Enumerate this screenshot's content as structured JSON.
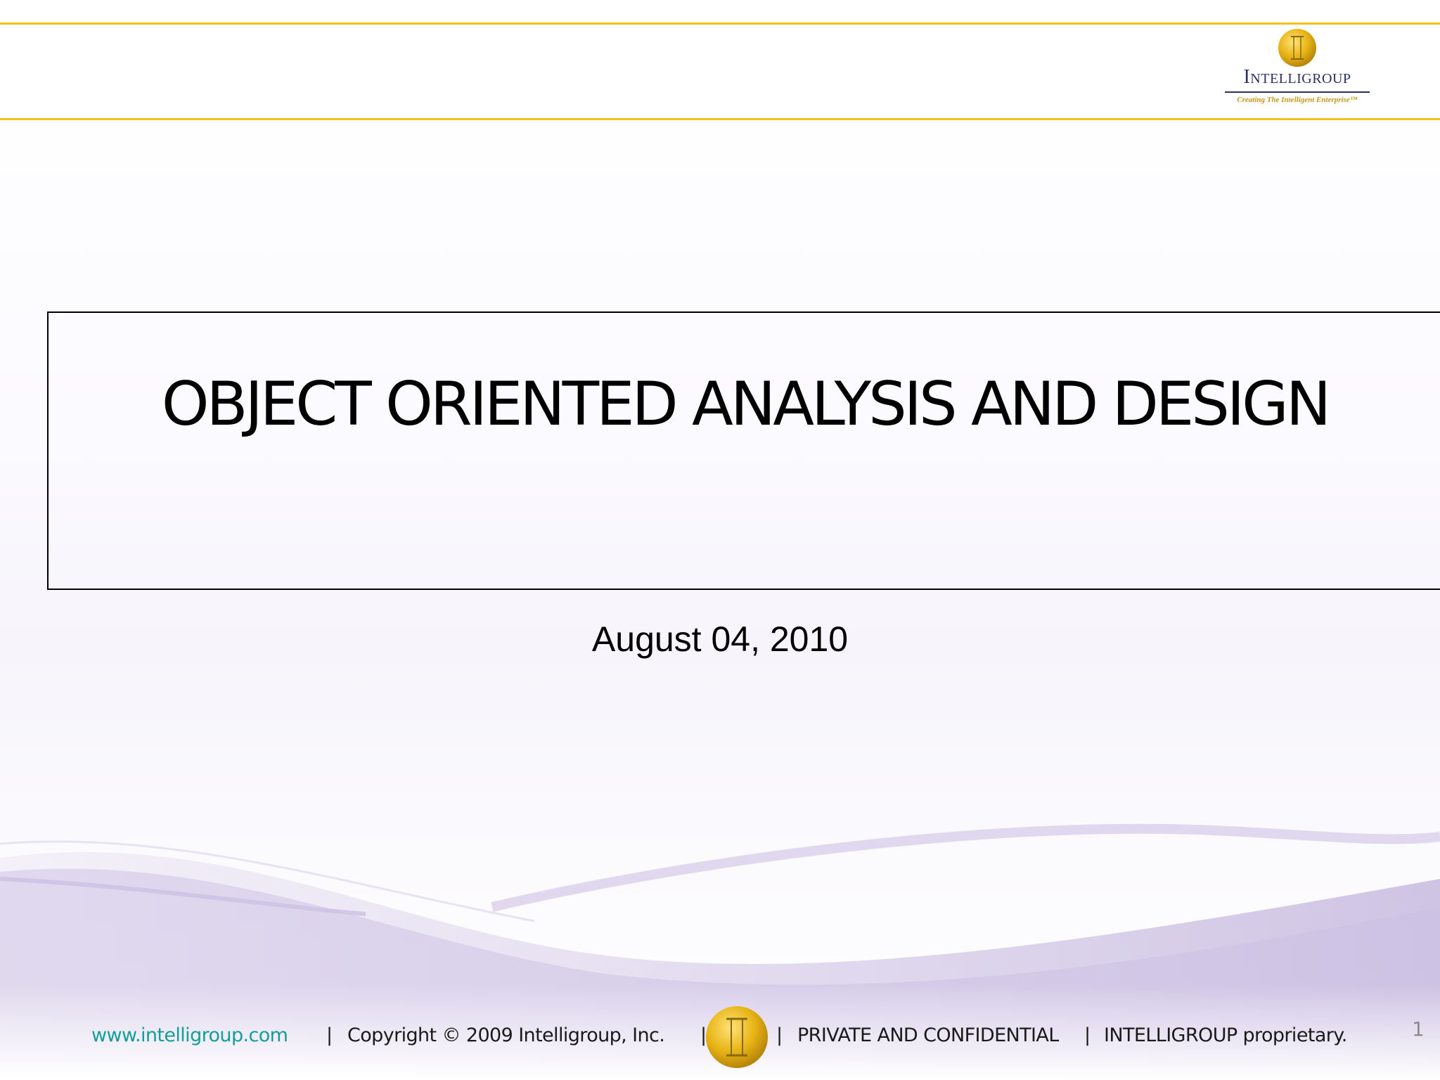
{
  "header": {
    "logo": {
      "name": "Intelligroup",
      "tagline": "Creating The Intelligent Enterprise™"
    }
  },
  "slide": {
    "title": "OBJECT ORIENTED ANALYSIS AND DESIGN",
    "date": "August 04, 2010",
    "page_number": "1"
  },
  "footer": {
    "url": "www.intelligroup.com",
    "separator": "|",
    "copyright": "Copyright © 2009 Intelligroup, Inc.",
    "confidential": "PRIVATE AND CONFIDENTIAL",
    "proprietary": "INTELLIGROUP proprietary."
  },
  "colors": {
    "accent_rule": "#f2c21a",
    "logo_navy": "#2b2f66",
    "logo_gold": "#c8961a",
    "url_teal": "#139e9a",
    "swoosh_purple": "#b9a9d6"
  }
}
